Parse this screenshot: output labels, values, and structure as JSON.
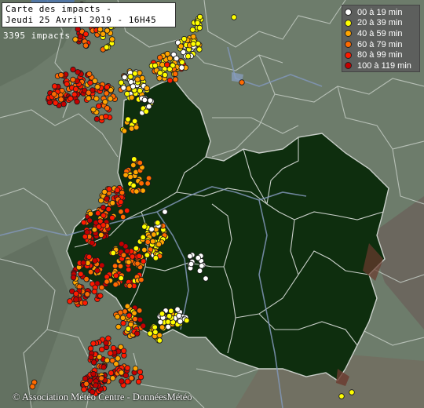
{
  "title": {
    "line1": "Carte des impacts -",
    "line2": "Jeudi 25 Avril 2019 - 16H45"
  },
  "impact_count": "3395 impacts",
  "legend": {
    "items": [
      {
        "label": "00 à 19 min",
        "color": "#ffffff"
      },
      {
        "label": "20 à 39 min",
        "color": "#ffff00"
      },
      {
        "label": "40 à 59 min",
        "color": "#ffa500"
      },
      {
        "label": "60 à 79 min",
        "color": "#ff6a00"
      },
      {
        "label": "80 à 99 min",
        "color": "#ff1a00"
      },
      {
        "label": "100 à 119 min",
        "color": "#c40000"
      }
    ]
  },
  "credit": "© Association Météo Centre - DonnéesMétéo",
  "colors": {
    "background": "#6e7d6c",
    "region_fill": "#0e2e0e",
    "border": "#c9cfc9",
    "river": "#7d93b4"
  }
}
